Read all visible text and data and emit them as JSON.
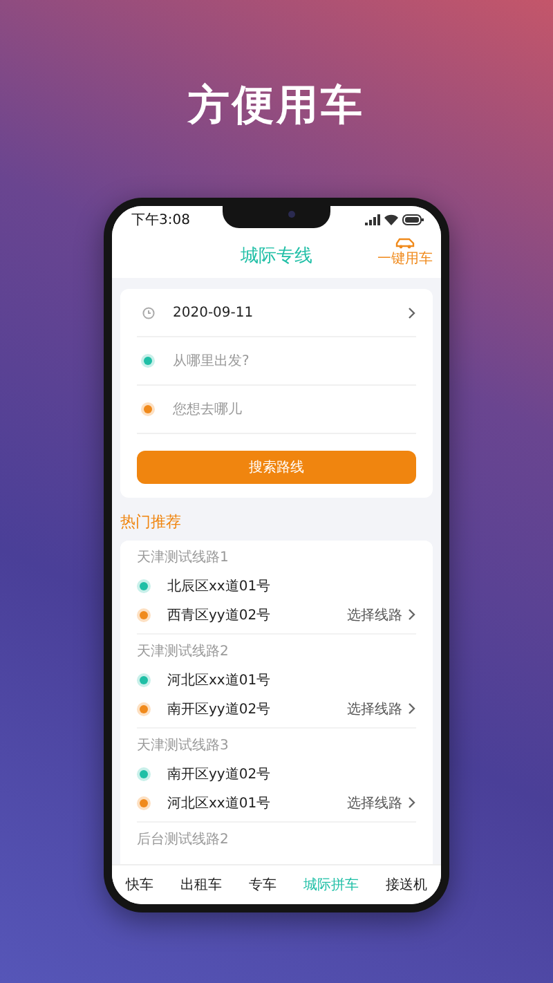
{
  "headline": "方便用车",
  "status_bar": {
    "time": "下午3:08"
  },
  "header": {
    "title": "城际专线",
    "action": "一键用车"
  },
  "search_form": {
    "date": "2020-09-11",
    "from": {
      "placeholder": "从哪里出发?"
    },
    "to": {
      "placeholder": "您想去哪儿"
    },
    "button": "搜索路线"
  },
  "hot_section": {
    "title": "热门推荐",
    "routes": [
      {
        "name": "天津测试线路1",
        "start": "北辰区xx道01号",
        "end": "西青区yy道02号",
        "action": "选择线路"
      },
      {
        "name": "天津测试线路2",
        "start": "河北区xx道01号",
        "end": "南开区yy道02号",
        "action": "选择线路"
      },
      {
        "name": "天津测试线路3",
        "start": "南开区yy道02号",
        "end": "河北区xx道01号",
        "action": "选择线路"
      },
      {
        "name": "后台测试线路2"
      }
    ]
  },
  "tab_bar": [
    {
      "label": "快车",
      "selected": false
    },
    {
      "label": "出租车",
      "selected": false
    },
    {
      "label": "专车",
      "selected": false
    },
    {
      "label": "城际拼车",
      "selected": true
    },
    {
      "label": "接送机",
      "selected": false
    }
  ]
}
